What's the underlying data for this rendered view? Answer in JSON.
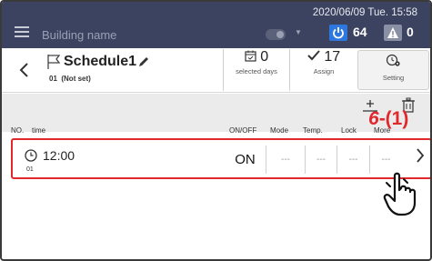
{
  "topbar": {
    "building_name": "Building name",
    "datetime": "2020/06/09 Tue. 15:58",
    "power_count": "64",
    "alert_count": "0"
  },
  "header": {
    "back_label": "<",
    "schedule_name": "Schedule1",
    "schedule_number": "01",
    "schedule_status": "(Not set)",
    "selected_days_value": "0",
    "selected_days_label": "selected days",
    "assign_value": "17",
    "assign_label": "Assign",
    "setting_label": "Setting"
  },
  "table": {
    "columns": [
      "NO.",
      "time",
      "ON/OFF",
      "Mode",
      "Temp.",
      "Lock",
      "More"
    ],
    "rows": [
      {
        "no": "01",
        "time": "12:00",
        "onoff": "ON",
        "mode": "---",
        "temp": "---",
        "lock": "---",
        "more": "---"
      }
    ]
  },
  "annotation": {
    "number": "6",
    "sub": "-(1)"
  },
  "colors": {
    "topbar": "#3c4360",
    "accent": "#2c78e0",
    "highlight": "#e0282d"
  },
  "icons": [
    "menu-icon",
    "toggle-icon",
    "power-icon",
    "alert-icon",
    "back-icon",
    "flag-icon",
    "pencil-icon",
    "calendar-icon",
    "check-icon",
    "clock-gear-icon",
    "add-row-icon",
    "delete-icon",
    "clock-icon",
    "chevron-right-icon",
    "hand-pointer-icon"
  ]
}
